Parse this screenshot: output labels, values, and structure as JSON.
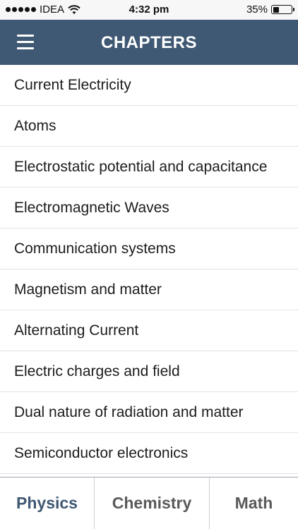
{
  "status_bar": {
    "carrier": "IDEA",
    "time": "4:32 pm",
    "battery": "35%",
    "battery_level": 0.35
  },
  "header": {
    "title": "CHAPTERS",
    "menu_icon": "hamburger-menu-icon"
  },
  "chapters": [
    "Current Electricity",
    "Atoms",
    "Electrostatic potential and capacitance",
    "Electromagnetic Waves",
    "Communication systems",
    "Magnetism and matter",
    "Alternating Current",
    "Electric charges and field",
    "Dual nature of radiation and matter",
    "Semiconductor electronics"
  ],
  "tabs": {
    "physics": "Physics",
    "chemistry": "Chemistry",
    "math": "Math",
    "active": "physics"
  },
  "colors": {
    "header_bg": "#3f5873",
    "active_tab": "#3f5873",
    "inactive_tab": "#5a5a5a"
  }
}
